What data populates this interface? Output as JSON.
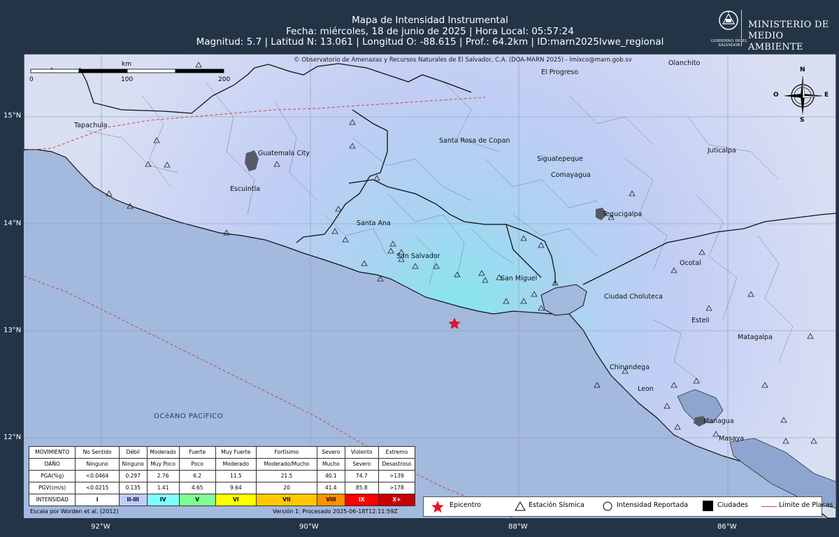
{
  "header": {
    "title": "Mapa de Intensidad Instrumental",
    "date_line": "Fecha: miércoles, 18 de junio de 2025 | Hora Local: 05:57:24",
    "params_line": "Magnitud: 5.7 | Latitud N: 13.061 | Longitud O: -88.615 | Prof.: 64.2km | ID:marn2025lvwe_regional"
  },
  "logo": {
    "gov": "GOBIERNO DE EL SALVADOR",
    "ministry_line1": "MINISTERIO DE",
    "ministry_line2": "MEDIO AMBIENTE"
  },
  "map": {
    "copyright": "© Observatorio de Amenazas y Recursos Naturales de El Salvador, C.A. (DOA-MARN 2025) - lmixco@marn.gob.sv",
    "ocean_label": "OCéANO PACíFICO",
    "lat_labels": [
      "15°N",
      "14°N",
      "13°N",
      "12°N"
    ],
    "lon_labels": [
      "92°W",
      "90°W",
      "88°W",
      "86°W"
    ],
    "scale": {
      "unit": "km",
      "ticks": [
        "0",
        "100",
        "200"
      ]
    },
    "compass": {
      "n": "N",
      "s": "S",
      "e": "E",
      "w": "O"
    },
    "cities": [
      "Tapachula",
      "Guatemala City",
      "Escuintla",
      "Santa Ana",
      "San Salvador",
      "San Miguel",
      "Santa Rosa de Copan",
      "El Progreso",
      "Olanchito",
      "Siguatepeque",
      "Comayagua",
      "Juticalpa",
      "Tegucigalpa",
      "Ocotal",
      "Ciudad Choluteca",
      "Esteli",
      "Matagalpa",
      "Chinandega",
      "Leon",
      "Managua",
      "Masaya"
    ],
    "epicenter": {
      "lat": 13.061,
      "lon": -88.615
    }
  },
  "intensity_table": {
    "rows": {
      "movimiento": [
        "MOVIMIENTO",
        "No Sentido",
        "Débil",
        "Moderado",
        "Fuerte",
        "Muy Fuerte",
        "Fortísimo",
        "Severo",
        "Violento",
        "Extremo"
      ],
      "dano": [
        "DAÑO",
        "Ninguno",
        "Ninguno",
        "Muy Poco",
        "Poco",
        "Moderado",
        "Moderado/Mucho",
        "Mucho",
        "Severo",
        "Desastroso"
      ],
      "pga": [
        "PGA(%g)",
        "<0.0464",
        "0.297",
        "2.76",
        "6.2",
        "11.5",
        "21.5",
        "40.1",
        "74.7",
        ">139"
      ],
      "pgv": [
        "PGV(cm/s)",
        "<0.0215",
        "0.135",
        "1.41",
        "4.65",
        "9.64",
        "20",
        "41.4",
        "85.8",
        ">178"
      ],
      "intensidad": [
        "INTENSIDAD",
        "I",
        "II-III",
        "IV",
        "V",
        "VI",
        "VII",
        "VIII",
        "IX",
        "X+"
      ]
    },
    "intensity_colors": [
      "#ffffff",
      "#bfccff",
      "#80ffff",
      "#7fff94",
      "#ffff00",
      "#ffc800",
      "#ff9100",
      "#ff0000",
      "#c80000"
    ],
    "note_left": "Escala por Worden et al. (2012)",
    "note_right": "Versión 1: Procesado 2025-06-18T12:11:59Z"
  },
  "legend": {
    "epicenter": "Epicentro",
    "station": "Estación Sísmica",
    "reported": "Intensidad Reportada",
    "cities": "Ciudades",
    "plates": "Límite de Placas"
  }
}
